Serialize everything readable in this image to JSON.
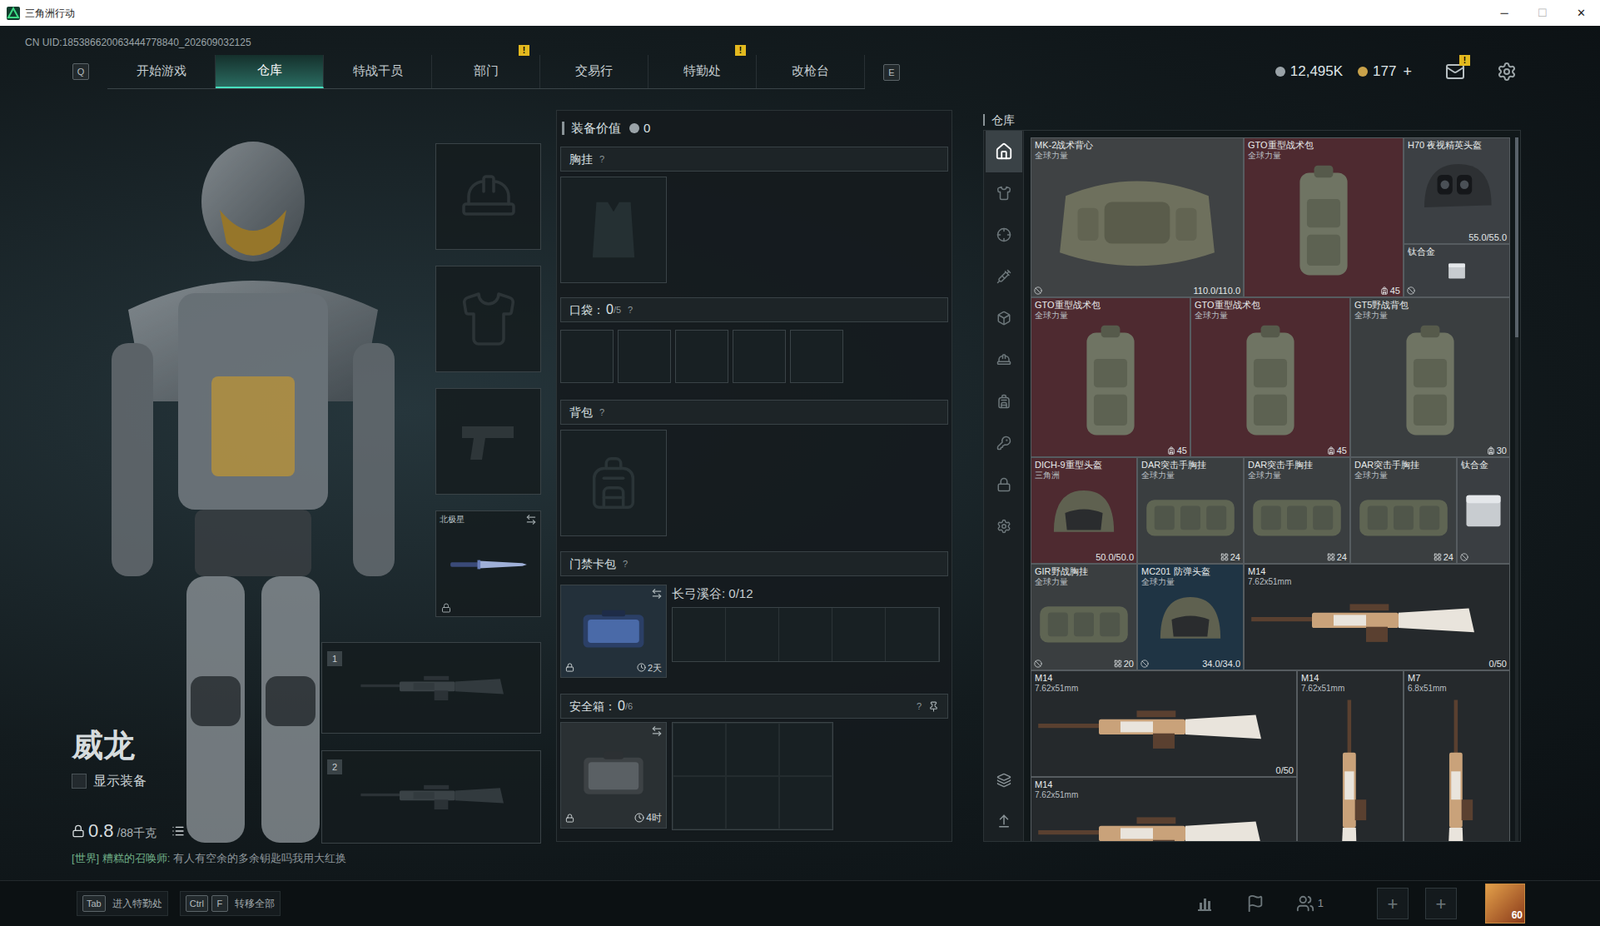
{
  "window": {
    "title": "三角洲行动",
    "controls": [
      {
        "glyph": "─",
        "disabled": false
      },
      {
        "glyph": "☐",
        "disabled": true
      },
      {
        "glyph": "✕",
        "disabled": false
      }
    ]
  },
  "uid": "CN UID:185386620063444778840_202609032125",
  "nav": {
    "prev_key": "Q",
    "next_key": "E",
    "alert_mark": "!",
    "tabs": [
      {
        "label": "开始游戏",
        "selected": false,
        "alert": false
      },
      {
        "label": "仓库",
        "selected": true,
        "alert": false
      },
      {
        "label": "特战干员",
        "selected": false,
        "alert": false
      },
      {
        "label": "部门",
        "selected": false,
        "alert": true
      },
      {
        "label": "交易行",
        "selected": false,
        "alert": false
      },
      {
        "label": "特勤处",
        "selected": false,
        "alert": true
      },
      {
        "label": "改枪台",
        "selected": false,
        "alert": false
      }
    ]
  },
  "wallet": {
    "currencies": [
      {
        "amount": "12,495K",
        "color": "#9aa3a8"
      },
      {
        "amount": "177",
        "color": "#c9a24a"
      }
    ],
    "add": "+",
    "mail_alert": true
  },
  "operator": {
    "name": "威龙",
    "show_gear": {
      "label": "显示装备",
      "checked": false
    },
    "weight": "0.8",
    "weight_limit": "/88千克"
  },
  "equipment_slots": [
    {
      "kind": "helmet",
      "locked": false
    },
    {
      "kind": "armor",
      "locked": false
    },
    {
      "kind": "pistol",
      "locked": false
    },
    {
      "kind": "melee",
      "label": "北极星",
      "locked": true
    }
  ],
  "weapon_slots": [
    {
      "number": "1"
    },
    {
      "number": "2"
    }
  ],
  "chat": {
    "channel": "[世界]",
    "sender": "糟糕的召唤师:",
    "message": "有人有空余的多余钥匙吗我用大红换"
  },
  "loadout": {
    "value_label": "装备价值",
    "value": "0",
    "help_mark": "?",
    "chest_rig": {
      "title": "胸挂"
    },
    "pockets": {
      "title": "口袋：",
      "count": "0",
      "capacity": "/5",
      "slots": 5
    },
    "backpack": {
      "title": "背包"
    },
    "keycard_case": {
      "title": "门禁卡包",
      "case_name": "长弓溪谷: 0/12",
      "timer": "2天",
      "locked": true
    },
    "safe_box": {
      "title": "安全箱：",
      "count": "0",
      "capacity": "/6",
      "slots": 6,
      "timer": "4时",
      "locked": true,
      "pinned": true
    }
  },
  "warehouse": {
    "title": "仓库",
    "sidebar": [
      {
        "kind": "all",
        "selected": true
      },
      {
        "kind": "armor",
        "selected": false
      },
      {
        "kind": "weapon",
        "selected": false
      },
      {
        "kind": "medical",
        "selected": false
      },
      {
        "kind": "ammo",
        "selected": false
      },
      {
        "kind": "helmet",
        "selected": false
      },
      {
        "kind": "container",
        "selected": false
      },
      {
        "kind": "key",
        "selected": false
      },
      {
        "kind": "locked",
        "selected": false
      },
      {
        "kind": "settings",
        "selected": false
      }
    ],
    "tools": [
      {
        "kind": "stack"
      },
      {
        "kind": "sort"
      }
    ],
    "items": [
      {
        "name": "MK-2战术背心",
        "faction": "全球力量",
        "kind": "vest",
        "durability": "110.0/110.0",
        "bound": true,
        "color": "#3f4244"
      },
      {
        "name": "GTO重型战术包",
        "faction": "全球力量",
        "kind": "backpack",
        "count": "45",
        "bound": false,
        "color": "#4e2a30"
      },
      {
        "name": "H70 夜视精英头盔",
        "kind": "nv-helmet",
        "durability": "55.0/55.0",
        "bound": false,
        "color": "#3c4044"
      },
      {
        "name": "钛合金",
        "kind": "plate",
        "bound": true,
        "color": "#3a3e42"
      },
      {
        "name": "GTO重型战术包",
        "faction": "全球力量",
        "kind": "backpack",
        "count": "45",
        "bound": false,
        "color": "#4e2a30"
      },
      {
        "name": "GTO重型战术包",
        "faction": "全球力量",
        "kind": "backpack",
        "count": "45",
        "bound": false,
        "color": "#4e2a30"
      },
      {
        "name": "GT5野战背包",
        "faction": "全球力量",
        "kind": "backpack",
        "count": "30",
        "bound": false,
        "color": "#3a3e40"
      },
      {
        "name": "DICH-9重型头盔",
        "faction": "三角洲",
        "kind": "helmet",
        "durability": "50.0/50.0",
        "bound": false,
        "color": "#4e2a30"
      },
      {
        "name": "DAR突击手胸挂",
        "faction": "全球力量",
        "kind": "rig",
        "count": "24",
        "bound": false,
        "color": "#3a3e40"
      },
      {
        "name": "DAR突击手胸挂",
        "faction": "全球力量",
        "kind": "rig",
        "count": "24",
        "bound": false,
        "color": "#3a3e40"
      },
      {
        "name": "DAR突击手胸挂",
        "faction": "全球力量",
        "kind": "rig",
        "count": "24",
        "bound": false,
        "color": "#3a3e40"
      },
      {
        "name": "钛合金",
        "kind": "plate",
        "bound": true,
        "color": "#3a3e42"
      },
      {
        "name": "GIR野战胸挂",
        "faction": "全球力量",
        "kind": "rig",
        "count": "20",
        "bound": true,
        "color": "#3a3e40"
      },
      {
        "name": "MC201 防弹头盔",
        "faction": "全球力量",
        "kind": "helmet",
        "durability": "34.0/34.0",
        "bound": true,
        "color": "#1f3444"
      },
      {
        "name": "M14",
        "faction": "7.62x51mm",
        "kind": "rifle",
        "ammo": "0/50",
        "bound": false,
        "color": "#25292c"
      },
      {
        "name": "M14",
        "faction": "7.62x51mm",
        "kind": "rifle",
        "ammo": "0/50",
        "bound": false,
        "color": "#25292c"
      },
      {
        "name": "M14",
        "faction": "7.62x51mm",
        "kind": "rifle-vertical",
        "bound": false,
        "color": "#25292c"
      },
      {
        "name": "M7",
        "faction": "6.8x51mm",
        "kind": "rifle-vertical",
        "bound": false,
        "color": "#25292c"
      },
      {
        "name": "M14",
        "faction": "7.62x51mm",
        "kind": "rifle",
        "bound": false,
        "color": "#25292c"
      }
    ]
  },
  "bottom_bar": {
    "hints": [
      {
        "keys": [
          "Tab"
        ],
        "label": "进入特勤处"
      },
      {
        "keys": [
          "Ctrl",
          "F"
        ],
        "label": "转移全部"
      }
    ],
    "party_count": "1",
    "add_slots": [
      "+",
      "+"
    ],
    "level": "60"
  }
}
